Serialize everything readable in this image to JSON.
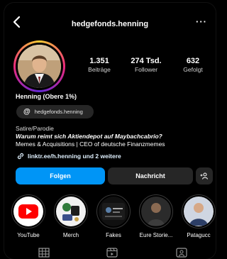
{
  "header": {
    "username": "hedgefonds.henning",
    "back_icon": "chevron-left-icon",
    "more_icon": "more-options-icon",
    "more_text": "···"
  },
  "profile": {
    "display_name": "Henning (Obere 1%)",
    "stats": [
      {
        "value": "1.351",
        "label": "Beiträge"
      },
      {
        "value": "274 Tsd.",
        "label": "Follower"
      },
      {
        "value": "632",
        "label": "Gefolgt"
      }
    ],
    "threads_handle": "hedgefonds.henning",
    "bio_category": "Satire/Parodie",
    "bio_line1": "Warum reimt sich Aktiendepot auf Maybachcabrio?",
    "bio_line2": "Memes & Acquisitions | CEO of deutsche Finanzmemes",
    "link_text": "linktr.ee/h.henning und 2 weitere"
  },
  "actions": {
    "follow_label": "Folgen",
    "message_label": "Nachricht",
    "add_user_label": "+₂"
  },
  "highlights": [
    {
      "label": "YouTube"
    },
    {
      "label": "Merch"
    },
    {
      "label": "Fakes"
    },
    {
      "label": "Eure Storie..."
    },
    {
      "label": "Patagucc"
    }
  ],
  "tabs": [
    "grid-icon",
    "reels-icon",
    "tagged-icon"
  ],
  "colors": {
    "accent": "#0095f6",
    "button_dark": "#262626",
    "background": "#000000"
  }
}
